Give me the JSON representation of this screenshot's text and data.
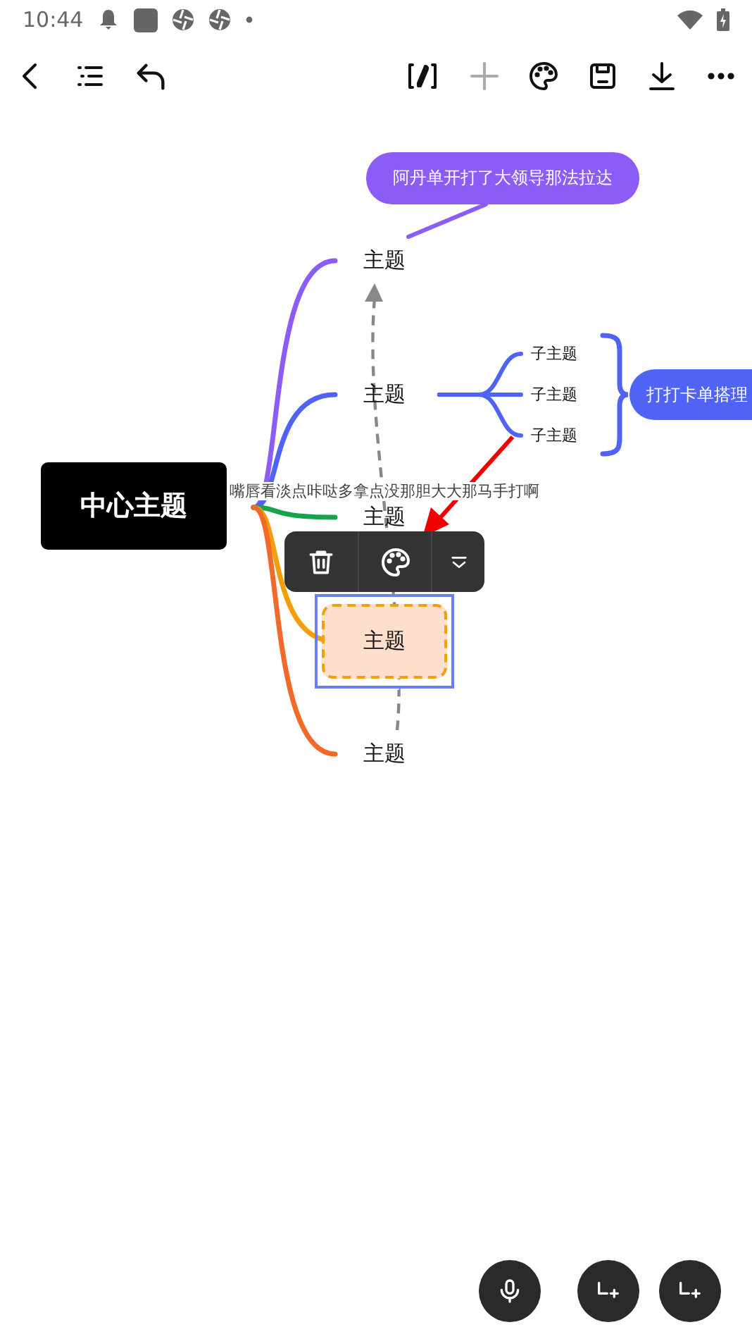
{
  "status_bar": {
    "time": "10:44"
  },
  "mindmap": {
    "center": "中心主题",
    "note": "嘴唇看淡点咔哒多拿点没那胆大大那马手打啊",
    "topics": [
      {
        "label": "主题",
        "color": "#8b5cf6",
        "selected": false,
        "callout": "阿丹单开打了大领导那法拉达"
      },
      {
        "label": "主题",
        "color": "#4f63f5",
        "selected": false,
        "children": [
          {
            "label": "子主题"
          },
          {
            "label": "子主题"
          },
          {
            "label": "子主题"
          }
        ],
        "summary": "打打卡单搭理"
      },
      {
        "label": "主题",
        "color": "#16a34a",
        "selected": false
      },
      {
        "label": "主题",
        "color": "#f59e0b",
        "selected": true
      },
      {
        "label": "主题",
        "color": "#f26a2a",
        "selected": false
      }
    ]
  }
}
